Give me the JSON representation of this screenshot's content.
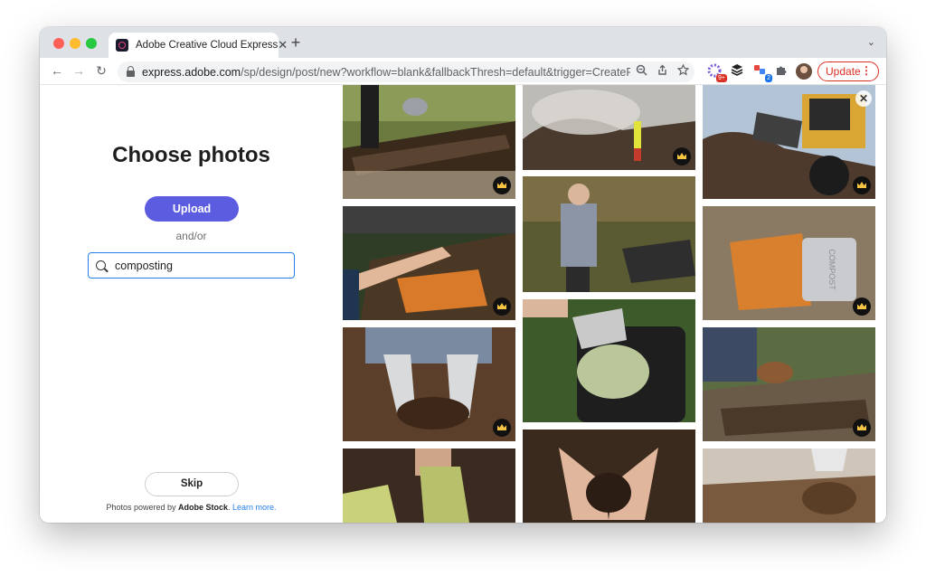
{
  "browser": {
    "tab_title": "Adobe Creative Cloud Express",
    "tab_close": "✕",
    "new_tab": "+",
    "tab_menu": "⌄",
    "url_host": "express.adobe.com",
    "url_path": "/sp/design/post/new?workflow=blank&fallbackThresh=default&trigger=CreatePro...",
    "update_label": "Update",
    "update_menu": "⋮",
    "extension_badge_1": "9+",
    "extension_badge_2": "2",
    "icons": [
      "back-arrow-icon",
      "forward-arrow-icon",
      "reload-icon",
      "lock-icon",
      "zoom-icon",
      "share-icon",
      "star-icon",
      "puzzle-icon"
    ]
  },
  "panel": {
    "title": "Choose photos",
    "upload_label": "Upload",
    "andor": "and/or",
    "search_value": "composting",
    "skip_label": "Skip",
    "credit_prefix": "Photos powered by ",
    "credit_brand": "Adobe Stock",
    "credit_suffix": ". ",
    "credit_link": "Learn more."
  },
  "photos": [
    {
      "subject": "compost-bed-watering",
      "premium": true
    },
    {
      "subject": "compost-bin-hand-scraps",
      "premium": true
    },
    {
      "subject": "gloved-hands-wood-chips",
      "premium": true
    },
    {
      "subject": "gloved-hands-compost",
      "premium": false
    },
    {
      "subject": "steaming-compost-pile-worker",
      "premium": true
    },
    {
      "subject": "boy-composting-garden",
      "premium": false
    },
    {
      "subject": "pouring-scraps-into-bin",
      "premium": false
    },
    {
      "subject": "hands-holding-soil",
      "premium": false
    },
    {
      "subject": "loader-turning-compost",
      "premium": true
    },
    {
      "subject": "vegetable-peels-compost-pail",
      "premium": true
    },
    {
      "subject": "raised-bed-bowl-scraps",
      "premium": true
    },
    {
      "subject": "gloved-hand-dropping-compost",
      "premium": false
    }
  ],
  "compost_pail_text": "COMPOST",
  "colors": {
    "accent": "#5c5ce0",
    "search_border": "#2680eb",
    "update_red": "#d93025",
    "crown": "#f6c443"
  }
}
